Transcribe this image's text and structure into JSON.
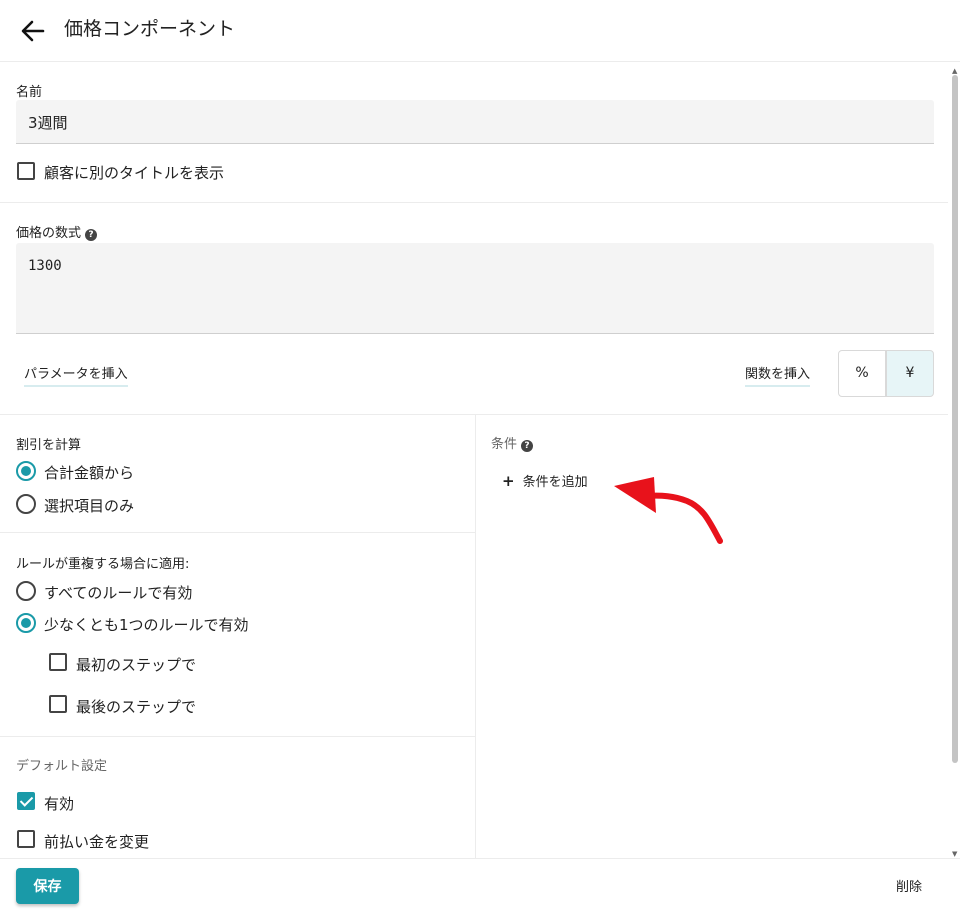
{
  "header": {
    "title": "価格コンポーネント",
    "back_icon": "arrow-left-icon"
  },
  "name_section": {
    "label": "名前",
    "value": "3週間",
    "alt_title_checkbox": {
      "label": "顧客に別のタイトルを表示",
      "checked": false
    }
  },
  "formula_section": {
    "label": "価格の数式",
    "help_icon": "question-circle-icon",
    "value": "1300",
    "insert_parameter": "パラメータを挿入",
    "insert_function": "関数を挿入",
    "unit_options": [
      "%",
      "¥"
    ],
    "selected_unit": "¥"
  },
  "discount_section": {
    "label": "割引を計算",
    "options": [
      {
        "label": "合計金額から",
        "selected": true
      },
      {
        "label": "選択項目のみ",
        "selected": false
      }
    ]
  },
  "overlap_section": {
    "label": "ルールが重複する場合に適用:",
    "options": [
      {
        "label": "すべてのルールで有効",
        "selected": false
      },
      {
        "label": "少なくとも1つのルールで有効",
        "selected": true
      }
    ],
    "sub_options": [
      {
        "label": "最初のステップで",
        "checked": false
      },
      {
        "label": "最後のステップで",
        "checked": false
      }
    ]
  },
  "defaults_section": {
    "label": "デフォルト設定",
    "options": [
      {
        "label": "有効",
        "checked": true
      },
      {
        "label": "前払い金を変更",
        "checked": false
      }
    ]
  },
  "conditions_section": {
    "label": "条件",
    "help_icon": "question-circle-icon",
    "add_label": "条件を追加",
    "annotation_color": "#e8121b"
  },
  "footer": {
    "save_label": "保存",
    "delete_label": "削除"
  },
  "colors": {
    "accent": "#1a9aa8",
    "unit_selected_bg": "#e7f5f7"
  }
}
